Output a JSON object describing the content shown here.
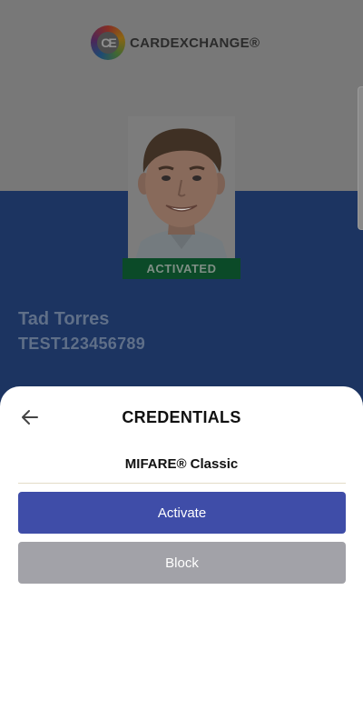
{
  "card": {
    "brand_name": "CARDEXCHANGE®",
    "logo_letters": "CE",
    "status": "ACTIVATED",
    "holder_name": "Tad Torres",
    "holder_id": "TEST123456789"
  },
  "sheet": {
    "title": "CREDENTIALS",
    "credential_type": "MIFARE® Classic",
    "activate_label": "Activate",
    "block_label": "Block"
  },
  "icons": {
    "back": "arrow-left-icon",
    "logo": "cardexchange-logo-icon",
    "photo": "person-avatar"
  },
  "colors": {
    "card_top_dimmed": "#787878",
    "card_bottom_dimmed": "#1c3461",
    "status_badge": "#0b4a28",
    "activate_button": "#3f4da8",
    "block_button": "#a2a2a8"
  }
}
